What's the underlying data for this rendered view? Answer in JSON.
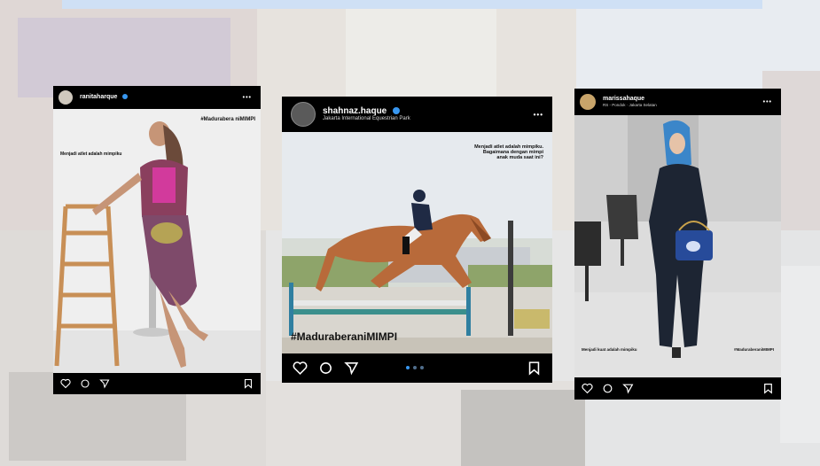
{
  "posts": [
    {
      "username": "ranitaharque",
      "location": "",
      "verified": true,
      "more_label": "•••",
      "hashtag": "#Madurabera niMIMPI",
      "caption": "Menjadi atlet adalah mimpiku",
      "icons": [
        "heart-icon",
        "comment-icon",
        "share-icon",
        "bookmark-icon"
      ]
    },
    {
      "username": "shahnaz.haque",
      "location": "Jakarta International Equestrian Park",
      "verified": true,
      "more_label": "•••",
      "hashtag": "#MaduraberaniMIMPI",
      "caption": "Menjadi atlet adalah mimpiku.\nBagaimana dengan mimpi\nanak muda saat ini?",
      "icons": [
        "heart-icon",
        "comment-icon",
        "share-icon",
        "carousel-dots",
        "bookmark-icon"
      ]
    },
    {
      "username": "marissahaque",
      "location": "RS - Pondok · Jakarta Selatan",
      "verified": false,
      "more_label": "•••",
      "hashtag": "#MaduraberaniMIMPI",
      "caption": "Menjadi kuat adalah mimpiku",
      "icons": [
        "heart-icon",
        "comment-icon",
        "share-icon",
        "bookmark-icon"
      ]
    }
  ],
  "colors": {
    "accent_blue": "#3897f0",
    "card_black": "#000000"
  }
}
